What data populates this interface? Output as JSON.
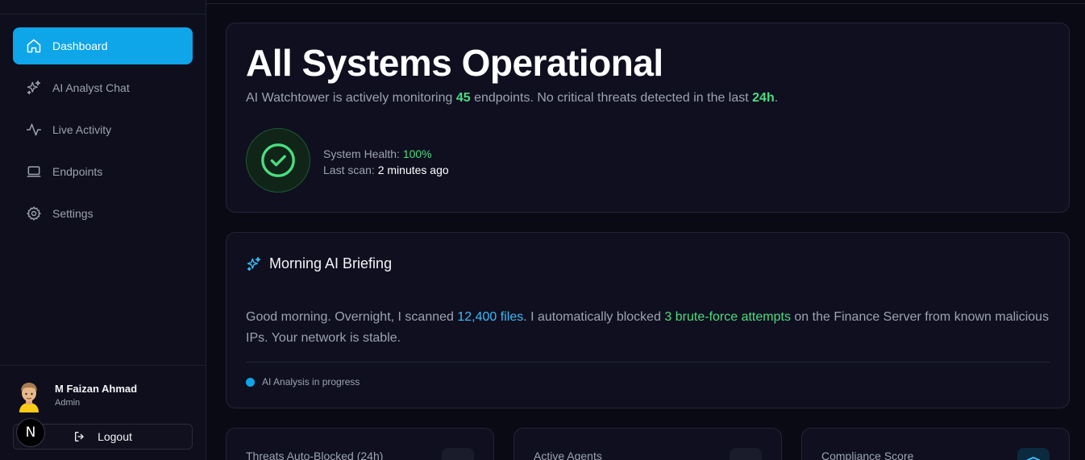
{
  "sidebar": {
    "items": [
      {
        "label": "Dashboard",
        "icon": "home-icon",
        "active": true
      },
      {
        "label": "AI Analyst Chat",
        "icon": "sparkles-icon"
      },
      {
        "label": "Live Activity",
        "icon": "activity-icon"
      },
      {
        "label": "Endpoints",
        "icon": "laptop-icon"
      },
      {
        "label": "Settings",
        "icon": "gear-icon"
      }
    ],
    "user": {
      "name": "M Faizan Ahmad",
      "role": "Admin"
    },
    "logout_label": "Logout",
    "badge_letter": "N"
  },
  "hero": {
    "title": "All Systems Operational",
    "sub_prefix": "AI Watchtower is actively monitoring ",
    "endpoints_count": "45",
    "sub_mid": " endpoints. No critical threats detected in the last ",
    "window": "24h",
    "sub_suffix": ".",
    "health_label": "System Health: ",
    "health_value": "100%",
    "scan_label": "Last scan: ",
    "scan_value": "2 minutes ago"
  },
  "briefing": {
    "title": "Morning AI Briefing",
    "text_1": "Good morning. Overnight, I scanned ",
    "files": "12,400 files",
    "text_2": ". I automatically blocked ",
    "attempts": "3 brute-force attempts",
    "text_3": " on the Finance Server from known malicious IPs. Your network is stable.",
    "status": "AI Analysis in progress"
  },
  "stats": [
    {
      "label": "Threats Auto-Blocked (24h)"
    },
    {
      "label": "Active Agents"
    },
    {
      "label": "Compliance Score"
    }
  ],
  "colors": {
    "accent": "#0ea5e9",
    "success": "#4ade80",
    "background": "#0a0a14"
  }
}
